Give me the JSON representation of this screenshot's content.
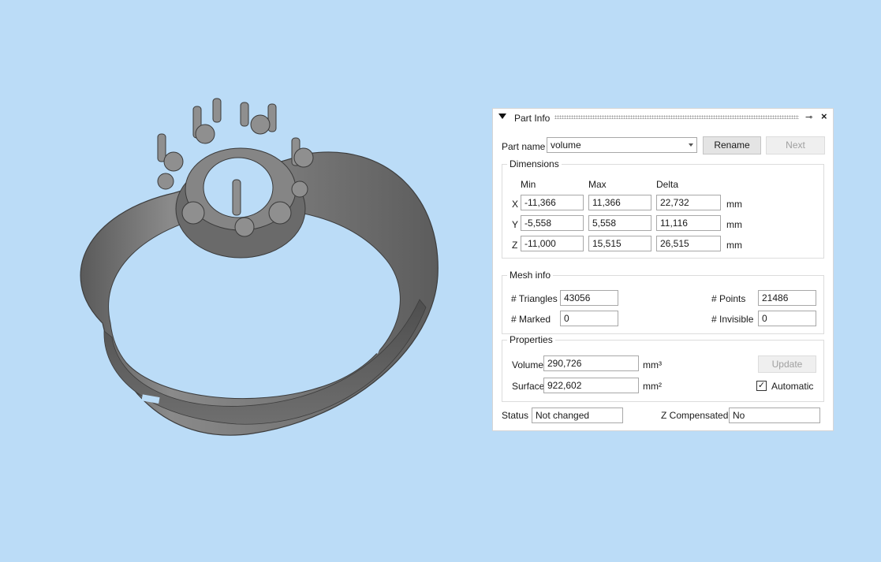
{
  "panel": {
    "title": "Part Info",
    "part_name_label": "Part name",
    "part_name_value": "volume",
    "rename_label": "Rename",
    "next_label": "Next",
    "dimensions": {
      "title": "Dimensions",
      "col_min": "Min",
      "col_max": "Max",
      "col_delta": "Delta",
      "unit": "mm",
      "rows": [
        {
          "axis": "X",
          "min": "-11,366",
          "max": "11,366",
          "delta": "22,732"
        },
        {
          "axis": "Y",
          "min": "-5,558",
          "max": "5,558",
          "delta": "11,116"
        },
        {
          "axis": "Z",
          "min": "-11,000",
          "max": "15,515",
          "delta": "26,515"
        }
      ]
    },
    "mesh_info": {
      "title": "Mesh info",
      "triangles_label": "# Triangles",
      "triangles_value": "43056",
      "points_label": "# Points",
      "points_value": "21486",
      "marked_label": "# Marked",
      "marked_value": "0",
      "invisible_label": "# Invisible",
      "invisible_value": "0"
    },
    "properties": {
      "title": "Properties",
      "volume_label": "Volume",
      "volume_value": "290,726",
      "volume_unit": "mm³",
      "surface_label": "Surface",
      "surface_value": "922,602",
      "surface_unit": "mm²",
      "update_label": "Update",
      "automatic_label": "Automatic",
      "automatic_checked": "✓"
    },
    "status_label": "Status",
    "status_value": "Not changed",
    "zcomp_label": "Z Compensated",
    "zcomp_value": "No"
  },
  "icons": {
    "collapse": "triangle-down-icon",
    "pin": "pin-icon",
    "close": "close-icon"
  },
  "colors": {
    "background": "#bbdcf7",
    "model": "#6e6e6e"
  }
}
